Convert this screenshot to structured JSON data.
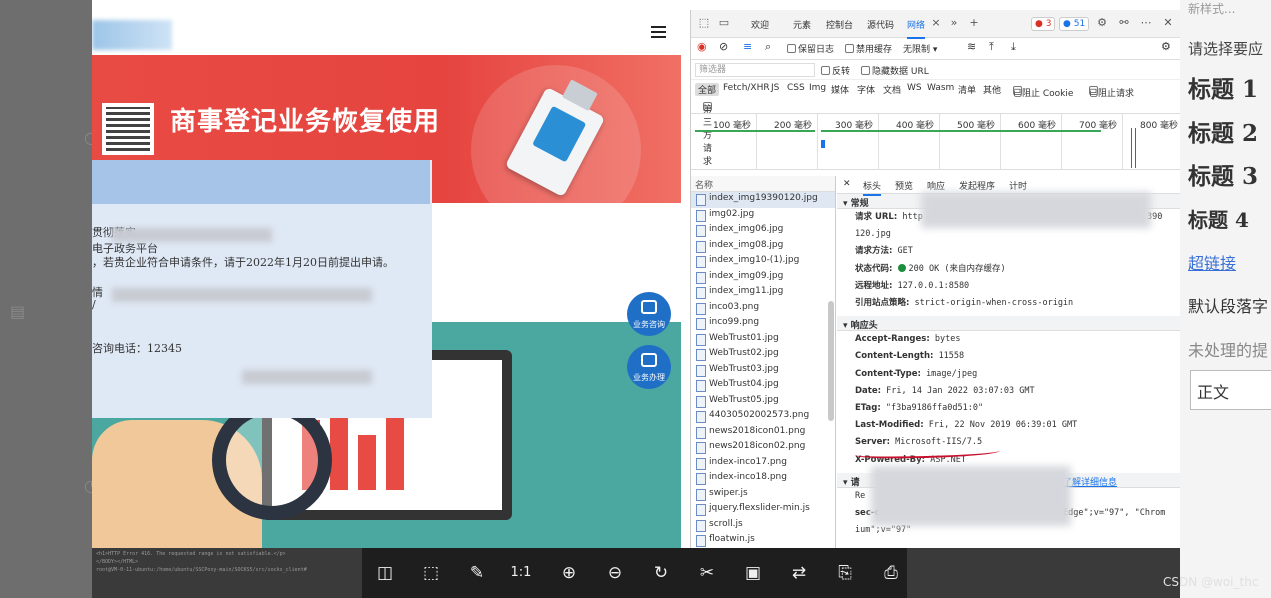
{
  "background_editor": {
    "top_text": "新样式...",
    "hint": "请选择要应",
    "heading1": "标题 1",
    "heading2": "标题 2",
    "heading3": "标题 3",
    "heading4": "标题 4",
    "link": "超链接",
    "paragraph": "默认段落字",
    "unprocessed": "未处理的提",
    "style_box": "正文"
  },
  "website": {
    "banner_title": "商事登记业务恢复使用",
    "notice_lines": [
      "贯彻落实",
      "电子政务平台",
      "，若贵企业符合申请条件，请于2022年1月20日前提出申请。",
      "情",
      "/",
      "咨询电话：12345"
    ],
    "fab_consult": "业务咨询",
    "fab_handle": "业务办理"
  },
  "devtools": {
    "tabs": [
      "欢迎",
      "元素",
      "控制台",
      "源代码",
      "网络"
    ],
    "active_tab": "网络",
    "errors_count": "3",
    "messages_count": "51",
    "toolbar": {
      "preserve_log": "保留日志",
      "disable_cache": "禁用缓存",
      "throttle": "无限制"
    },
    "filter_placeholder": "筛选器",
    "filter_invert": "反转",
    "hide_data_urls": "隐藏数据 URL",
    "types": [
      "全部",
      "Fetch/XHR",
      "JS",
      "CSS",
      "Img",
      "媒体",
      "字体",
      "文档",
      "WS",
      "Wasm",
      "清单",
      "其他"
    ],
    "blocked_cookies": "已阻止 Cookie",
    "blocked_requests": "已阻止请求",
    "third_party": "第三方请求",
    "timeline_ticks": [
      "100 毫秒",
      "200 毫秒",
      "300 毫秒",
      "400 毫秒",
      "500 毫秒",
      "600 毫秒",
      "700 毫秒",
      "800 毫秒"
    ],
    "name_header": "名称",
    "files": [
      "index_img19390120.jpg",
      "img02.jpg",
      "index_img06.jpg",
      "index_img08.jpg",
      "index_img10-(1).jpg",
      "index_img09.jpg",
      "index_img11.jpg",
      "inco03.png",
      "inco99.png",
      "WebTrust01.jpg",
      "WebTrust02.jpg",
      "WebTrust03.jpg",
      "WebTrust04.jpg",
      "WebTrust05.jpg",
      "44030502002573.png",
      "news2018icon01.png",
      "news2018icon02.png",
      "index-inco17.png",
      "index-inco18.png",
      "swiper.js",
      "jquery.flexslider-min.js",
      "scroll.js",
      "floatwin.js"
    ],
    "detail_tabs": [
      "标头",
      "预览",
      "响应",
      "发起程序",
      "计时"
    ],
    "general_title": "常规",
    "general": {
      "request_url_label": "请求 URL:",
      "request_url_start": "http",
      "request_url_tail1": "390",
      "request_url_tail2": "120.jpg",
      "method_label": "请求方法:",
      "method": "GET",
      "status_label": "状态代码:",
      "status": "200 OK (来自内存缓存)",
      "remote_label": "远程地址:",
      "remote": "127.0.0.1:8580",
      "referrer_label": "引用站点策略:",
      "referrer": "strict-origin-when-cross-origin"
    },
    "response_title": "响应头",
    "response_headers": [
      {
        "k": "Accept-Ranges:",
        "v": "bytes"
      },
      {
        "k": "Content-Length:",
        "v": "11558"
      },
      {
        "k": "Content-Type:",
        "v": "image/jpeg"
      },
      {
        "k": "Date:",
        "v": "Fri, 14 Jan 2022 03:07:03 GMT"
      },
      {
        "k": "ETag:",
        "v": "\"f3ba9186ffa0d51:0\""
      },
      {
        "k": "Last-Modified:",
        "v": "Fri, 22 Nov 2019 06:39:01 GMT"
      },
      {
        "k": "Server:",
        "v": "Microsoft-IIS/7.5"
      },
      {
        "k": "X-Powered-By:",
        "v": "ASP.NET"
      }
    ],
    "request_title": "请",
    "learn_more": "了解详细信息",
    "req_line_r": "Re",
    "req_line_sec": "sec-c",
    "req_line_sec_val": "Edge\";v=\"97\", \"Chrom",
    "req_line_ium": "ium\";v=\"97\""
  },
  "terminal_lines": [
    "<h1>HTTP Error 416. The requested range is not satisfiable.</p>",
    "</BODY></HTML>",
    "root@VM-0-11-ubuntu:/home/ubuntu/SSCPoxy-main/SOCKS5/src/socks_client#"
  ],
  "viewer_buttons": [
    "fit",
    "select",
    "edit",
    "1:1",
    "zoom-in",
    "zoom-out",
    "rotate",
    "crop",
    "image",
    "convert",
    "save",
    "print"
  ],
  "one_to_one_label": "1:1",
  "watermark": "CSDN @woi_thc"
}
